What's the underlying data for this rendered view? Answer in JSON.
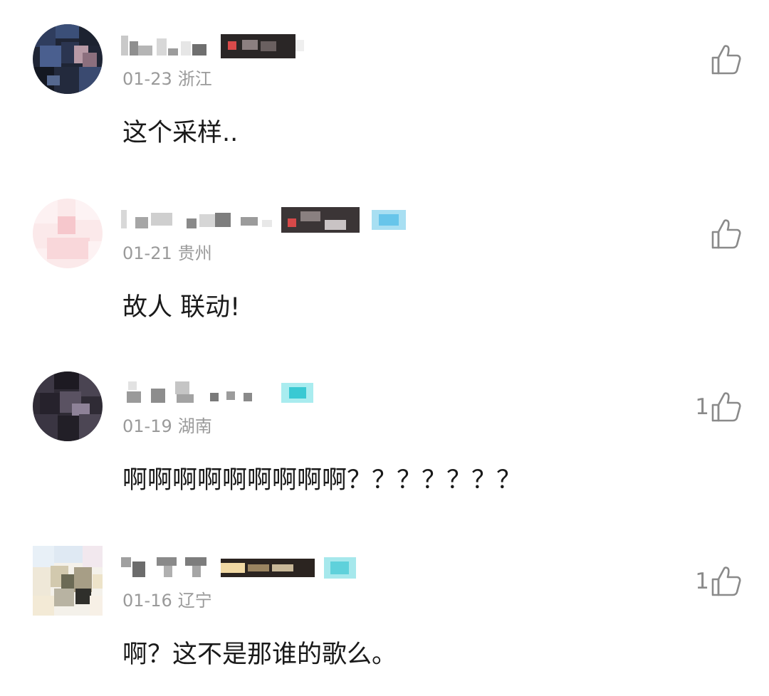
{
  "comments": [
    {
      "date": "01-23",
      "location": "浙江",
      "text": "这个采样..",
      "likes": ""
    },
    {
      "date": "01-21",
      "location": "贵州",
      "text": "故人 联动!",
      "likes": ""
    },
    {
      "date": "01-19",
      "location": "湖南",
      "text": "啊啊啊啊啊啊啊啊啊？？？？？？？",
      "likes": "1"
    },
    {
      "date": "01-16",
      "location": "辽宁",
      "text": "啊？这不是那谁的歌么。",
      "likes": "1"
    }
  ],
  "icons": {
    "like": "thumbs-up-icon"
  },
  "colors": {
    "meta_text": "#9a9a9a",
    "body_text": "#1a1a1a",
    "icon": "#8a8a8a"
  }
}
